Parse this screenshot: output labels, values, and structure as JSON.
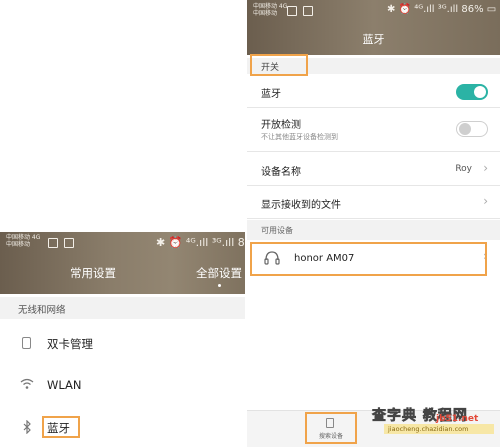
{
  "left": {
    "status": {
      "carrier_line1": "中国移动 4G",
      "carrier_line2": "中国移动",
      "right_text": "✱ ⏰ ⁴ᴳ.ıll ³ᴳ.ıll 85"
    },
    "tabs": [
      "常用设置",
      "全部设置"
    ],
    "section_title": "无线和网络",
    "items": [
      {
        "label": "双卡管理",
        "icon": "sim-card-icon"
      },
      {
        "label": "WLAN",
        "icon": "wifi-icon"
      },
      {
        "label": "蓝牙",
        "icon": "bluetooth-icon"
      }
    ]
  },
  "right": {
    "status": {
      "carrier_line1": "中国移动 4G",
      "carrier_line2": "中国移动",
      "right_text": "✱ ⏰ ⁴ᴳ.ıll ³ᴳ.ıll 86% ▭ 09:19"
    },
    "title": "蓝牙",
    "switch_section": "开关",
    "rows": {
      "bluetooth": {
        "label": "蓝牙",
        "on": true
      },
      "visible": {
        "label": "开放检测",
        "sub": "不让其他蓝牙设备检测到",
        "on": false
      },
      "device_name": {
        "label": "设备名称",
        "value": "Roy"
      },
      "received_files": {
        "label": "显示接收到的文件"
      }
    },
    "available_section": "可用设备",
    "device": {
      "name": "honor AM07",
      "icon": "headset-icon"
    },
    "scan_button": "搜索设备"
  },
  "watermark": {
    "logo": "查字典 教程网",
    "site": "jb51.net",
    "url": "jiaocheng.chazidian.com"
  },
  "colors": {
    "header_brown": "#7f725f",
    "highlight_orange": "#f0a34a",
    "toggle_teal": "#2bb3a5"
  }
}
